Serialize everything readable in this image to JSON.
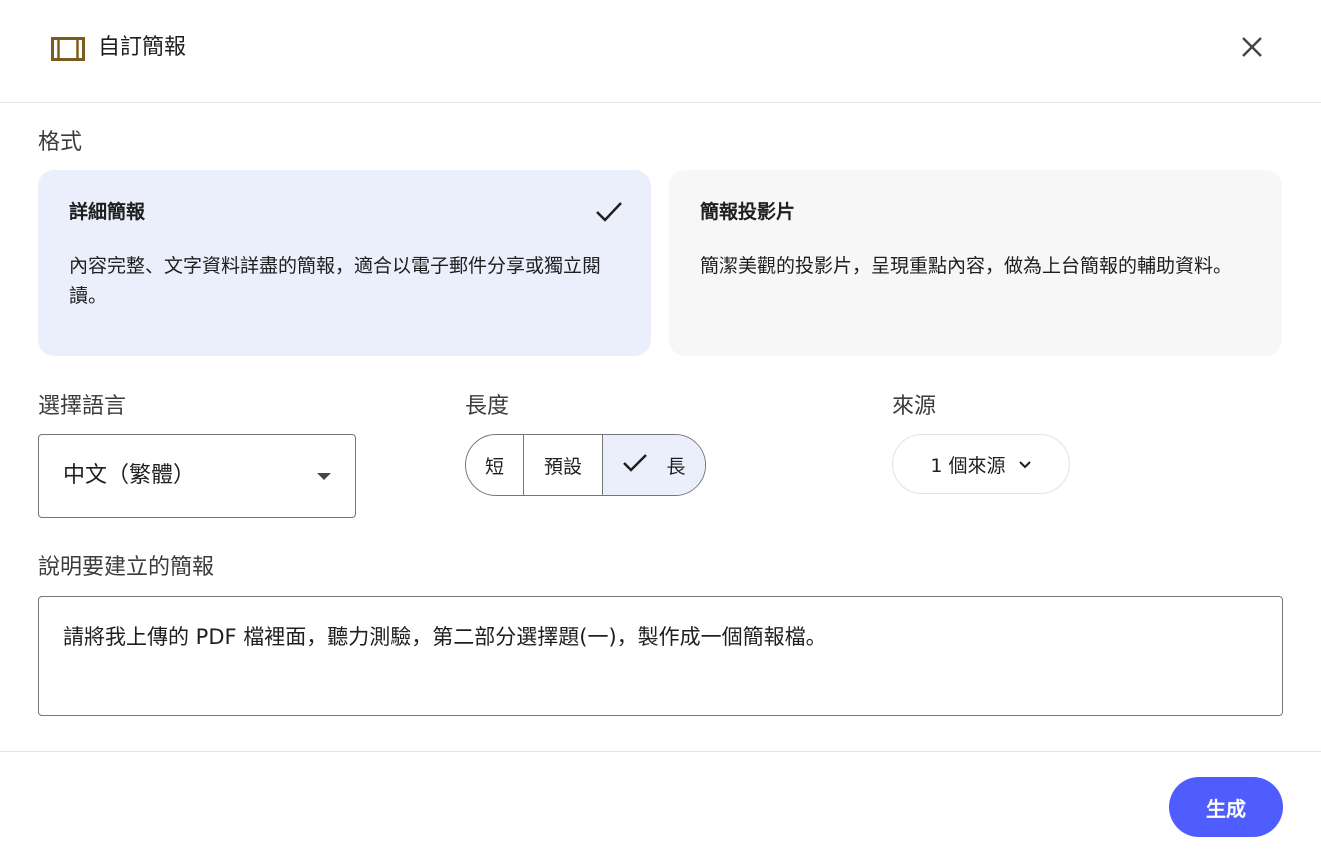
{
  "header": {
    "title": "自訂簡報",
    "icon": "slides-icon",
    "close_icon": "close-icon",
    "icon_color": "#7a5c1e"
  },
  "format": {
    "label": "格式",
    "options": [
      {
        "title": "詳細簡報",
        "description": "內容完整、文字資料詳盡的簡報，適合以電子郵件分享或獨立閱讀。",
        "selected": true
      },
      {
        "title": "簡報投影片",
        "description": "簡潔美觀的投影片，呈現重點內容，做為上台簡報的輔助資料。",
        "selected": false
      }
    ]
  },
  "language": {
    "label": "選擇語言",
    "value": "中文（繁體）"
  },
  "length": {
    "label": "長度",
    "options": [
      "短",
      "預設",
      "長"
    ],
    "selected": "長"
  },
  "source": {
    "label": "來源",
    "value": "1 個來源"
  },
  "description": {
    "label": "說明要建立的簡報",
    "value": "請將我上傳的 PDF 檔裡面，聽力測驗，第二部分選擇題(一)，製作成一個簡報檔。"
  },
  "footer": {
    "generate_label": "生成",
    "accent_color": "#4f5dff"
  }
}
